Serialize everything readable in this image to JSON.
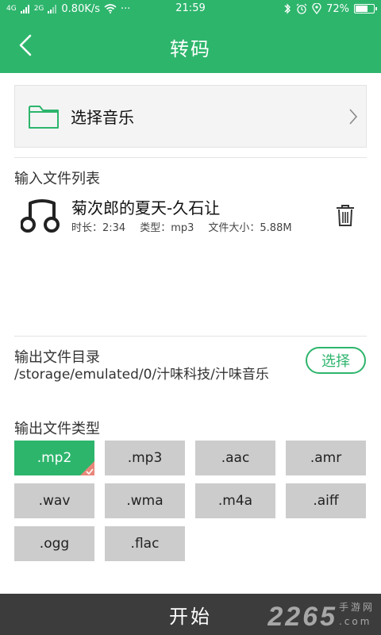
{
  "status_bar": {
    "network_speed": "0.80K/s",
    "more": "···",
    "time": "21:59",
    "battery_percent": "72%",
    "battery_level": 0.72,
    "signal_1": "4G",
    "signal_2": "2G"
  },
  "header": {
    "title": "转码"
  },
  "picker": {
    "label": "选择音乐"
  },
  "input_list": {
    "heading": "输入文件列表",
    "files": [
      {
        "name": "菊次郎的夏天-久石让",
        "duration": "时长：2:34",
        "type": "类型：mp3",
        "size": "文件大小：5.88M"
      }
    ]
  },
  "output_dir": {
    "heading": "输出文件目录",
    "path": "/storage/emulated/0/汁味科技/汁味音乐",
    "select_label": "选择"
  },
  "output_type": {
    "heading": "输出文件类型",
    "selected": ".mp2",
    "options": [
      ".mp2",
      ".mp3",
      ".aac",
      ".amr",
      ".wav",
      ".wma",
      ".m4a",
      ".aiff",
      ".ogg",
      ".flac"
    ]
  },
  "footer": {
    "start_label": "开始"
  },
  "watermark": {
    "number": "2265",
    "text": "手游网",
    "domain": ".com"
  },
  "colors": {
    "accent": "#2db56c",
    "footer": "#3c3c3c",
    "type_button": "#cccccc"
  }
}
